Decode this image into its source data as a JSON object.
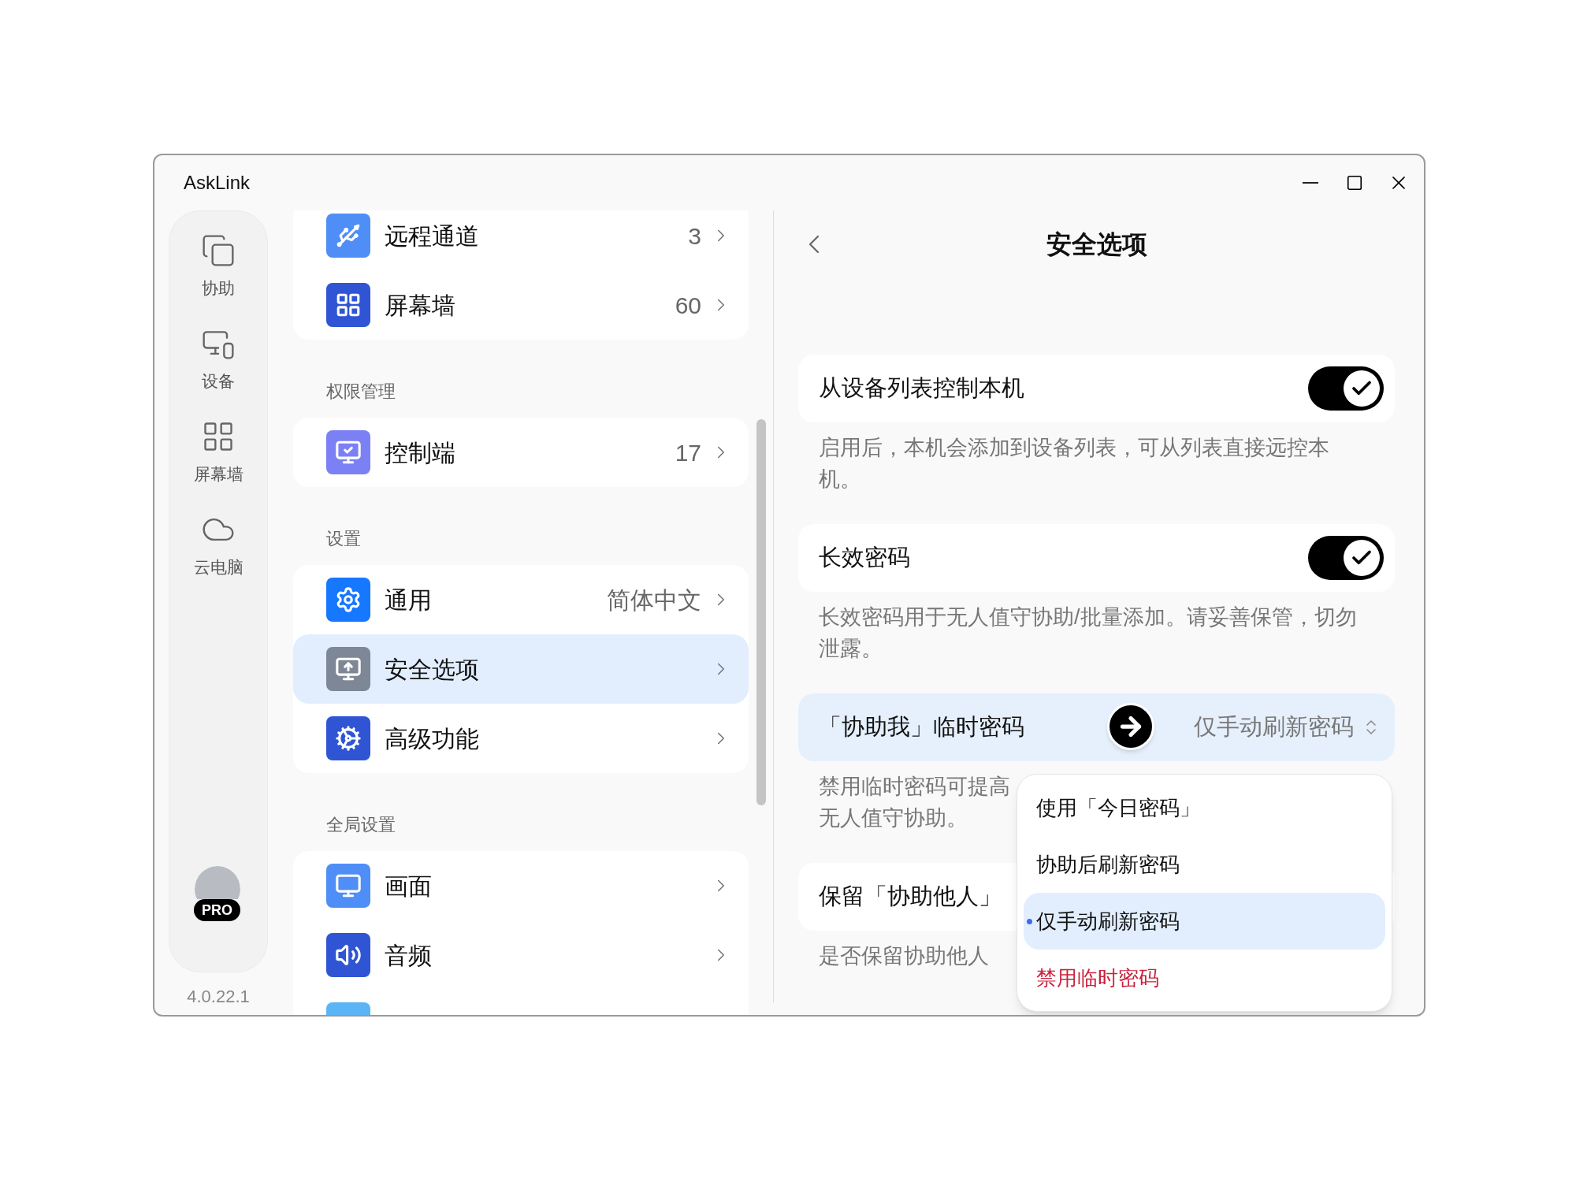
{
  "window": {
    "title": "AskLink"
  },
  "rail": {
    "items": [
      {
        "label": "协助"
      },
      {
        "label": "设备"
      },
      {
        "label": "屏幕墙"
      },
      {
        "label": "云电脑"
      }
    ],
    "badge": "PRO",
    "version": "4.0.22.1"
  },
  "list": {
    "groups": [
      {
        "items": [
          {
            "label": "远程通道",
            "value": "3",
            "selected": false
          },
          {
            "label": "屏幕墙",
            "value": "60",
            "selected": false
          }
        ]
      },
      {
        "heading": "权限管理",
        "items": [
          {
            "label": "控制端",
            "value": "17",
            "selected": false
          }
        ]
      },
      {
        "heading": "设置",
        "items": [
          {
            "label": "通用",
            "value": "简体中文",
            "selected": false
          },
          {
            "label": "安全选项",
            "selected": true
          },
          {
            "label": "高级功能",
            "selected": false
          }
        ]
      },
      {
        "heading": "全局设置",
        "items": [
          {
            "label": "画面",
            "selected": false
          },
          {
            "label": "音频",
            "selected": false
          },
          {
            "kind": "cut"
          }
        ]
      }
    ]
  },
  "panel": {
    "title": "安全选项",
    "settings": [
      {
        "kind": "toggle",
        "label": "从设备列表控制本机",
        "on": true,
        "description": [
          "启用后，本机会添加到设备列表，可从列表直接远控本机。"
        ]
      },
      {
        "kind": "toggle",
        "label": "长效密码",
        "on": true,
        "description": [
          "长效密码用于无人值守协助/批量添加。请妥善保管，切勿泄露。"
        ]
      },
      {
        "kind": "select",
        "label": "「协助我」临时密码",
        "value": "仅手动刷新密码",
        "open": true,
        "description": [
          "禁用临时密码可提高",
          "无人值守协助。"
        ]
      },
      {
        "kind": "plain",
        "label": "保留「协助他人」",
        "description": [
          "是否保留协助他人"
        ]
      }
    ],
    "dropdown": {
      "options": [
        {
          "label": "使用「今日密码」",
          "selected": false,
          "kind": "normal"
        },
        {
          "label": "协助后刷新密码",
          "selected": false,
          "kind": "normal"
        },
        {
          "label": "仅手动刷新密码",
          "selected": true,
          "kind": "normal"
        },
        {
          "label": "禁用临时密码",
          "selected": false,
          "kind": "danger"
        }
      ]
    }
  }
}
